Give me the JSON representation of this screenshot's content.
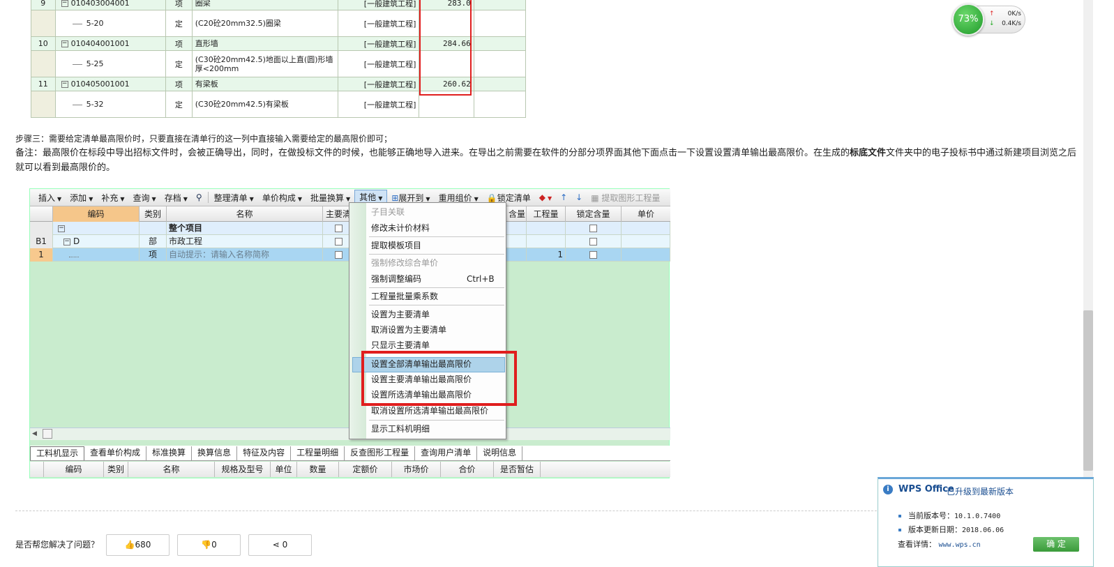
{
  "top_table": {
    "rows": [
      {
        "type": "item",
        "idx": "9",
        "code": "010403004001",
        "kind": "项",
        "name": "圈梁",
        "cat": "[一般建筑工程]",
        "val": "283.0"
      },
      {
        "type": "sub",
        "code": "5-20",
        "kind": "定",
        "name": "(C20砼20mm32.5)圈梁",
        "cat": "[一般建筑工程]"
      },
      {
        "type": "item",
        "idx": "10",
        "code": "010404001001",
        "kind": "项",
        "name": "直形墙",
        "cat": "[一般建筑工程]",
        "val": "284.66"
      },
      {
        "type": "sub",
        "code": "5-25",
        "kind": "定",
        "name": "(C30砼20mm42.5)地面以上直(圆)形墙厚<200mm",
        "cat": "[一般建筑工程]"
      },
      {
        "type": "item",
        "idx": "11",
        "code": "010405001001",
        "kind": "项",
        "name": "有梁板",
        "cat": "[一般建筑工程]",
        "val": "260.62"
      },
      {
        "type": "sub",
        "code": "5-32",
        "kind": "定",
        "name": "(C30砼20mm42.5)有梁板",
        "cat": "[一般建筑工程]"
      }
    ]
  },
  "step3": "步骤三：需要给定清单最高限价时，只要直接在清单行的这一列中直接输入需要给定的最高限价即可；",
  "note": {
    "part1": "备注：最高限价在标段中导出招标文件时，会被正确导出，同时，在做投标文件的时候，也能够正确地导入进来。在导出之前需要在软件的分部分项界面其他下面点击一下设置设置清单输出最高限价。在生成的",
    "bold": "标底文件",
    "part2": "文件夹中的电子投标书中通过新建项目浏览之后就可以看到最高限价的。"
  },
  "toolbar": {
    "items": [
      "插入",
      "添加",
      "补充",
      "查询",
      "存档",
      "整理清单",
      "单价构成",
      "批量换算",
      "其他",
      "展开到",
      "重用组价",
      "锁定清单",
      "提取图形工程量"
    ]
  },
  "grid": {
    "headers": [
      "编码",
      "类别",
      "名称",
      "主要清单",
      "含量",
      "工程量",
      "锁定含量",
      "单价"
    ],
    "rows": [
      {
        "idx": "",
        "code": "",
        "kind": "",
        "name": "整个项目",
        "qty": ""
      },
      {
        "idx": "B1",
        "code": "D",
        "kind": "部",
        "name": "市政工程",
        "qty": ""
      },
      {
        "idx": "1",
        "code": "",
        "kind": "项",
        "name": "自动提示：请输入名称简称",
        "qty": "1"
      }
    ]
  },
  "menu": {
    "items": [
      {
        "label": "子目关联",
        "disabled": true
      },
      {
        "label": "修改未计价材料"
      },
      {
        "label": "提取模板项目"
      },
      {
        "label": "强制修改综合单价",
        "disabled": true
      },
      {
        "label": "强制调整编码",
        "shortcut": "Ctrl+B"
      },
      {
        "label": "工程量批量乘系数"
      },
      {
        "label": "设置为主要清单"
      },
      {
        "label": "取消设置为主要清单"
      },
      {
        "label": "只显示主要清单"
      },
      {
        "label": "设置全部清单输出最高限价"
      },
      {
        "label": "设置主要清单输出最高限价"
      },
      {
        "label": "设置所选清单输出最高限价"
      },
      {
        "label": "取消设置所选清单输出最高限价"
      },
      {
        "label": "显示工料机明细"
      }
    ]
  },
  "bottom_tabs": [
    "工料机显示",
    "查看单价构成",
    "标准换算",
    "换算信息",
    "特征及内容",
    "工程量明细",
    "反查图形工程量",
    "查询用户清单",
    "说明信息"
  ],
  "sub_headers": [
    "编码",
    "类别",
    "名称",
    "规格及型号",
    "单位",
    "数量",
    "定额价",
    "市场价",
    "合价",
    "是否暂估"
  ],
  "speed": {
    "percent": "73%",
    "up": "0K/s",
    "down": "0.4K/s"
  },
  "wps": {
    "logo": "WPS Office",
    "title": "已升级到最新版本",
    "version_label": "当前版本号：",
    "version": "10.1.0.7400",
    "date_label": "版本更新日期：",
    "date": "2018.06.06",
    "detail_label": "查看详情：",
    "link": "www.wps.cn",
    "ok": "确 定"
  },
  "footer": {
    "question": "是否帮您解决了问题？",
    "like": "680",
    "dislike": "0",
    "share": "0"
  },
  "colors": {
    "highlight_red": "#e01e1e",
    "grid_green": "#c9ecce",
    "wps_blue": "#1a4e91"
  }
}
